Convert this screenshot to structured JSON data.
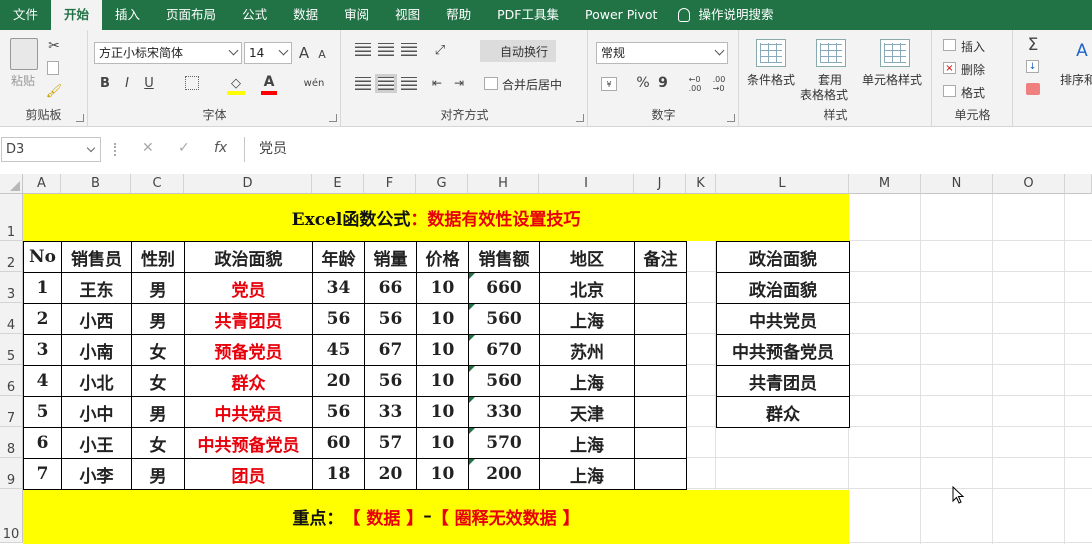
{
  "menu": {
    "items": [
      "文件",
      "开始",
      "插入",
      "页面布局",
      "公式",
      "数据",
      "审阅",
      "视图",
      "帮助",
      "PDF工具集",
      "Power Pivot"
    ],
    "active_index": 1,
    "search_label": "操作说明搜索"
  },
  "ribbon": {
    "clipboard": {
      "label": "剪贴板",
      "paste": "粘贴"
    },
    "font": {
      "label": "字体",
      "name": "方正小标宋简体",
      "size": "14",
      "grow": "A",
      "shrink": "A",
      "bold": "B",
      "italic": "I",
      "underline": "U",
      "wen": "wén",
      "fill_color": "#ffff00",
      "font_color": "#ff0000"
    },
    "alignment": {
      "label": "对齐方式",
      "wrap": "自动换行",
      "merge": "合并后居中"
    },
    "number": {
      "label": "数字",
      "format": "常规",
      "percent": "%",
      "comma": "9",
      "inc": "←0\n.00",
      "dec": ".00\n→0"
    },
    "styles": {
      "label": "样式",
      "conditional": "条件格式",
      "table_line1": "套用",
      "table_line2": "表格格式",
      "cell_styles": "单元格样式"
    },
    "cells": {
      "label": "单元格",
      "insert": "插入",
      "delete": "删除",
      "format": "格式"
    },
    "editing": {
      "sort": "排序和"
    }
  },
  "formula_bar": {
    "name_box": "D3",
    "content": "党员",
    "cancel": "✕",
    "enter": "✓",
    "fx": "fx"
  },
  "columns": [
    "A",
    "B",
    "C",
    "D",
    "E",
    "F",
    "G",
    "H",
    "I",
    "J",
    "K",
    "L",
    "M",
    "N",
    "O"
  ],
  "rows": [
    "1",
    "2",
    "3",
    "4",
    "5",
    "6",
    "7",
    "8",
    "9",
    "10"
  ],
  "sheet": {
    "title_black": "Excel函数公式",
    "title_colon": "：",
    "title_red": "数据有效性设置技巧",
    "headers": [
      "No",
      "销售员",
      "性别",
      "政治面貌",
      "年龄",
      "销量",
      "价格",
      "销售额",
      "地区",
      "备注"
    ],
    "records": [
      [
        "1",
        "王东",
        "男",
        "党员",
        "34",
        "66",
        "10",
        "660",
        "北京",
        ""
      ],
      [
        "2",
        "小西",
        "男",
        "共青团员",
        "56",
        "56",
        "10",
        "560",
        "上海",
        ""
      ],
      [
        "3",
        "小南",
        "女",
        "预备党员",
        "45",
        "67",
        "10",
        "670",
        "苏州",
        ""
      ],
      [
        "4",
        "小北",
        "女",
        "群众",
        "20",
        "56",
        "10",
        "560",
        "上海",
        ""
      ],
      [
        "5",
        "小中",
        "男",
        "中共党员",
        "56",
        "33",
        "10",
        "330",
        "天津",
        ""
      ],
      [
        "6",
        "小王",
        "女",
        "中共预备党员",
        "60",
        "57",
        "10",
        "570",
        "上海",
        ""
      ],
      [
        "7",
        "小李",
        "男",
        "团员",
        "18",
        "20",
        "10",
        "200",
        "上海",
        ""
      ]
    ],
    "lookup_list": [
      "政治面貌",
      "政治面貌",
      "中共党员",
      "中共预备党员",
      "共青团员",
      "群众"
    ],
    "focus_black": "重点：",
    "focus_red1": "【 数据 】",
    "focus_dash": "–",
    "focus_red2": "【 圈释无效数据 】",
    "highlight_color": "#ffff00"
  }
}
